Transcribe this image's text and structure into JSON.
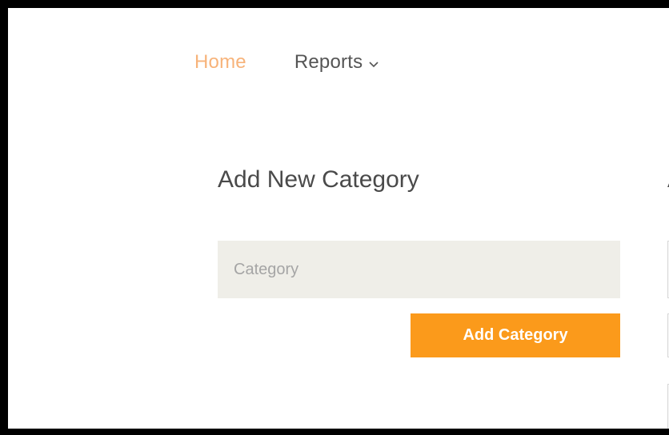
{
  "nav": {
    "home_label": "Home",
    "reports_label": "Reports"
  },
  "form": {
    "title": "Add New Category",
    "category_placeholder": "Category",
    "category_value": "",
    "submit_label": "Add Category"
  },
  "right_panel": {
    "title_fragment": "A"
  },
  "colors": {
    "accent": "#fb9a1b",
    "active_nav": "#f7b37a",
    "input_bg": "#efeee8"
  },
  "icons": {
    "reports_dropdown": "chevron-down-icon"
  }
}
